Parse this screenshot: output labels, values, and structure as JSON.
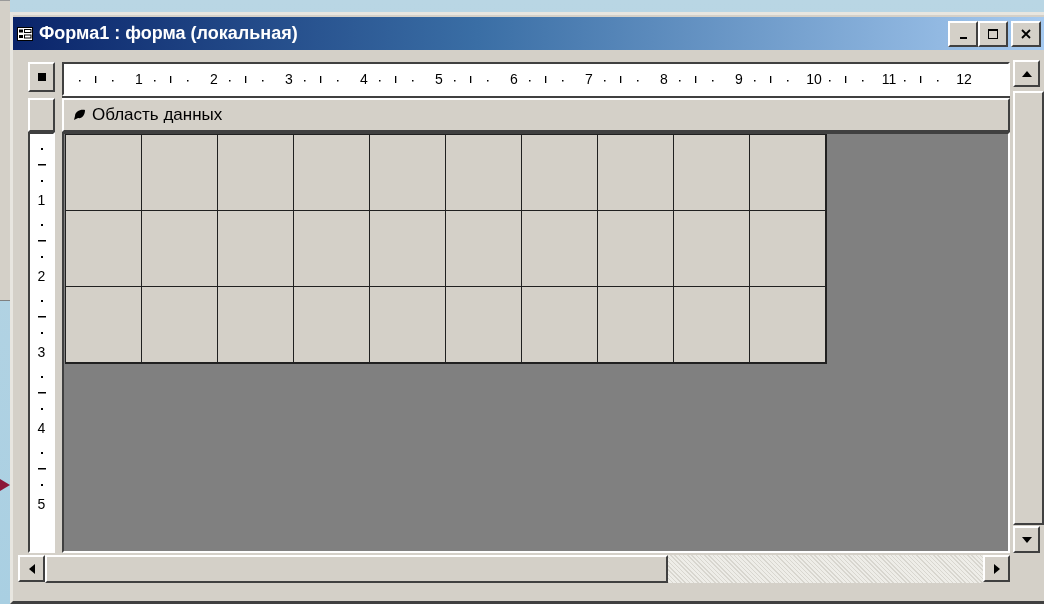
{
  "window": {
    "title": "Форма1 : форма (локальная)"
  },
  "ruler": {
    "labels": [
      "1",
      "2",
      "3",
      "4",
      "5",
      "6",
      "7",
      "8",
      "9",
      "10",
      "11",
      "12"
    ]
  },
  "vertical_ruler": {
    "labels": [
      "1",
      "2",
      "3",
      "4",
      "5"
    ]
  },
  "section": {
    "title": "Область данных"
  }
}
